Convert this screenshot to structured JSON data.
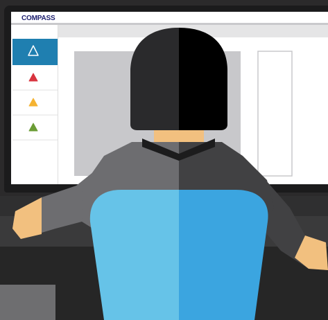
{
  "app": {
    "brand_label": "COMPASS"
  },
  "sidebar": {
    "items": [
      {
        "icon": "triangle-outline-icon",
        "color": "#ffffff",
        "active": true
      },
      {
        "icon": "triangle-red-icon",
        "color": "#d8343f",
        "active": false
      },
      {
        "icon": "triangle-yellow-icon",
        "color": "#f5b332",
        "active": false
      },
      {
        "icon": "triangle-green-icon",
        "color": "#6b9c35",
        "active": false
      }
    ]
  },
  "colors": {
    "brand_text": "#1f2170",
    "sidebar_active": "#1f7fb0",
    "chair_left": "#66c3e8",
    "chair_right": "#3ba5e0",
    "monitor_frame": "#2a2a2a",
    "desk": "#3a3a3a",
    "background": "#2b2a2b"
  }
}
